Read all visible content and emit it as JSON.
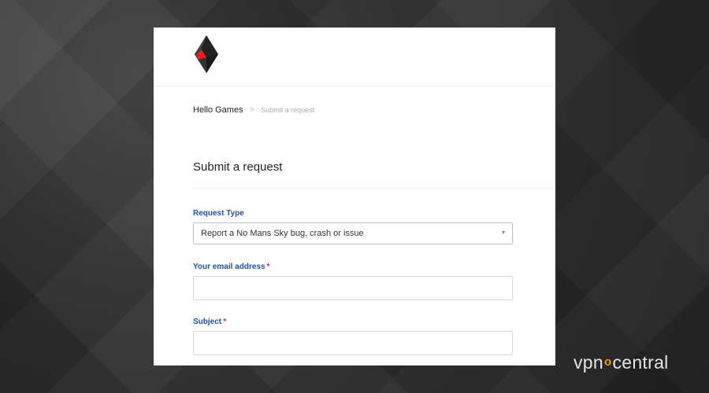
{
  "breadcrumb": {
    "home": "Hello Games",
    "separator": ">",
    "current": "Submit a request"
  },
  "page": {
    "title": "Submit a request"
  },
  "form": {
    "request_type": {
      "label": "Request Type",
      "selected": "Report a No Mans Sky bug, crash or issue"
    },
    "email": {
      "label": "Your email address",
      "required_marker": "*",
      "value": ""
    },
    "subject": {
      "label": "Subject",
      "required_marker": "*",
      "value": ""
    }
  },
  "watermark": {
    "part1": "vpn",
    "accent": "o",
    "part2": "central"
  },
  "icons": {
    "logo": "no-mans-sky-logo-icon",
    "dropdown": "chevron-down-icon"
  },
  "colors": {
    "label_blue": "#1f4f9e",
    "required_red": "#d6202f",
    "logo_red": "#e02127",
    "watermark_accent": "#f0a41c"
  }
}
